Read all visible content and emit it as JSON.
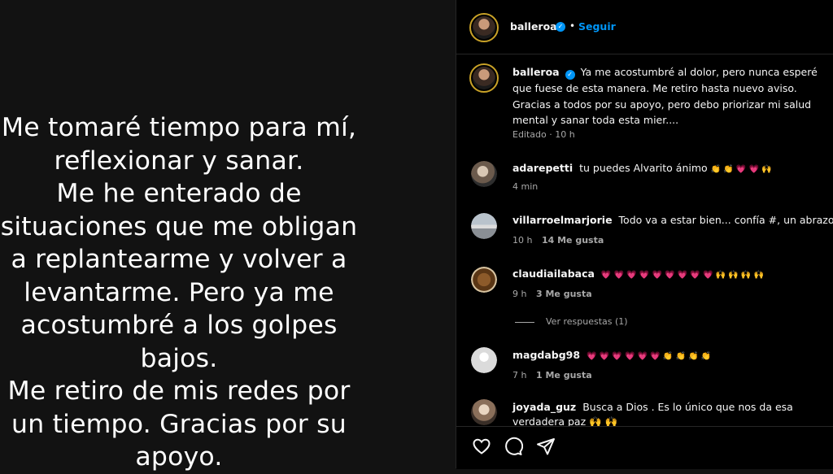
{
  "story": {
    "lines": [
      "Me tomaré tiempo para mí,",
      "reflexionar y sanar.",
      "Me he enterado de",
      "situaciones que me obligan",
      "a replantearme y volver a",
      "levantarme. Pero ya me",
      "acostumbré a los golpes",
      "bajos.",
      "Me retiro de mis redes por",
      "un tiempo. Gracias por su",
      "apoyo."
    ]
  },
  "header": {
    "username": "balleroa",
    "separator": "•",
    "follow_label": "Seguir"
  },
  "caption": {
    "username": "balleroa",
    "text": "Ya me acostumbré al dolor, pero nunca esperé que fuese de esta manera. Me retiro hasta nuevo aviso. Gracias a todos por su apoyo, pero debo priorizar mi salud mental y sanar toda esta mier....",
    "edited": "Editado · 10 h"
  },
  "comments": [
    {
      "username": "adarepetti",
      "text": "tu puedes Alvarito ánimo",
      "emojis": "👏 👏 💗 💗 🙌",
      "time": "4 min",
      "likes": ""
    },
    {
      "username": "villarroelmarjorie",
      "text": "Todo va a estar bien... confía #, un abrazo",
      "emojis": "💕",
      "time": "10 h",
      "likes": "14 Me gusta"
    },
    {
      "username": "claudiailabaca",
      "text": "",
      "emojis": "💗 💗 💗 💗 💗 💗 💗 💗 💗 🙌 🙌 🙌 🙌",
      "time": "9 h",
      "likes": "3 Me gusta"
    },
    {
      "username": "magdabg98",
      "text": "",
      "emojis": "💗 💗 💗 💗 💗 💗 👏 👏 👏 👏",
      "time": "7 h",
      "likes": "1 Me gusta"
    },
    {
      "username": "joyada_guz",
      "text": "Busca a Dios . Es lo único que nos da esa",
      "text2": "verdadera paz 🙌 🙌",
      "emojis": "",
      "time": "",
      "likes": ""
    }
  ],
  "replies_label": "Ver respuestas (1)",
  "actions": [
    "heart-icon",
    "comment-icon",
    "share-icon"
  ]
}
